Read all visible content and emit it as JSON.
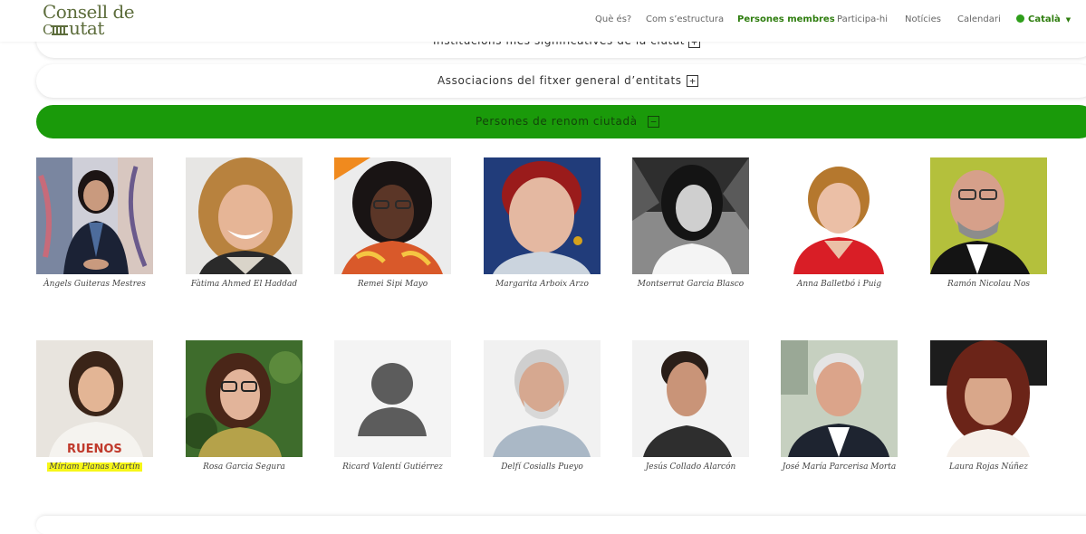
{
  "header": {
    "logo_line1": "Consell de",
    "logo_line2": "utat",
    "nav": [
      {
        "label": "Què és?",
        "active": false
      },
      {
        "label": "Com s’estructura",
        "active": false
      },
      {
        "label": "Persones membres",
        "active": true
      },
      {
        "label": "Participa-hi",
        "active": false
      },
      {
        "label": "Notícies",
        "active": false
      },
      {
        "label": "Calendari",
        "active": false
      }
    ],
    "language": "Català"
  },
  "accordions": [
    {
      "label": "Institucions més significatives de la ciutat",
      "toggle": "+",
      "expanded": false
    },
    {
      "label": "Associacions del fitxer general d’entitats",
      "toggle": "+",
      "expanded": false
    },
    {
      "label": "Persones de renom ciutadà",
      "toggle": "−",
      "expanded": true
    }
  ],
  "colors": {
    "accent": "#1a9a0a",
    "nav_active": "#2e7d0e",
    "logo": "#5d6d3c",
    "highlight": "#f7f719"
  },
  "people": [
    {
      "name": "Àngels Guiteras Mestres",
      "photo": "portrait"
    },
    {
      "name": "Fàtima Ahmed El Haddad",
      "photo": "portrait"
    },
    {
      "name": "Remei Sipi Mayo",
      "photo": "portrait"
    },
    {
      "name": "Margarita Arboix Arzo",
      "photo": "portrait"
    },
    {
      "name": "Montserrat Garcia Blasco",
      "photo": "portrait"
    },
    {
      "name": "Anna Balletbó i Puig",
      "photo": "portrait"
    },
    {
      "name": "Ramón Nicolau Nos",
      "photo": "portrait"
    },
    {
      "name": "Míriam Planas Martín",
      "photo": "portrait",
      "highlighted": true
    },
    {
      "name": "Rosa Garcia Segura",
      "photo": "portrait"
    },
    {
      "name": "Ricard Valentí Gutiérrez",
      "photo": "avatar-placeholder-icon"
    },
    {
      "name": "Delfí Cosialls Pueyo",
      "photo": "portrait"
    },
    {
      "name": "Jesús Collado Alarcón",
      "photo": "portrait"
    },
    {
      "name": "José María Parcerisa Morta",
      "photo": "portrait"
    },
    {
      "name": "Laura Rojas Núñez",
      "photo": "portrait"
    }
  ]
}
